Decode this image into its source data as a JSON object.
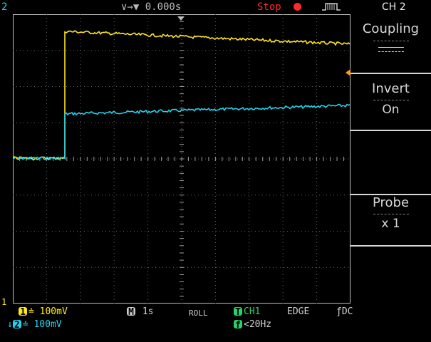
{
  "topbar": {
    "ch_marker": "2",
    "trigger_position": "∨→▼ 0.000s",
    "run_state": "Stop",
    "channel_menu_title": "CH 2"
  },
  "menu": {
    "coupling": {
      "title": "Coupling",
      "value": ""
    },
    "invert": {
      "title": "Invert",
      "value": "On"
    },
    "probe": {
      "title": "Probe",
      "value": "x 1"
    }
  },
  "bottombar": {
    "ch1_scale": "100mV",
    "ch2_scale": "100mV",
    "timebase": "1s",
    "mode": "ROLL",
    "trigger_source": "CH1",
    "trigger_type": "EDGE",
    "trigger_coupling": "DC",
    "trigger_filter": "<20Hz",
    "ch1_badge": "1",
    "ch2_badge": "2",
    "math_badge": "M",
    "trig_badge": "T",
    "filter_badge": "f",
    "ch1_marker": "1"
  },
  "colors": {
    "ch1": "#ffe81a",
    "ch2": "#22d3ee",
    "trigger": "#24d36b",
    "stop": "#ff2a2a"
  }
}
